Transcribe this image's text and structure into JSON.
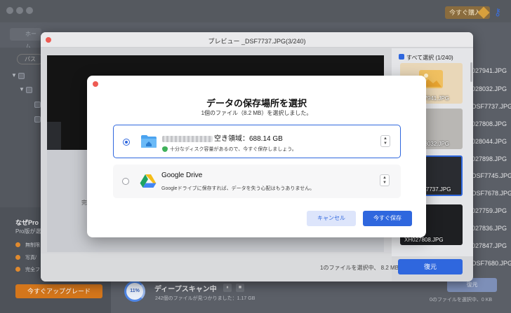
{
  "app": {
    "buy_label": "今すぐ購入",
    "nav_label": "ホーム",
    "path_label": "パス",
    "upsell": {
      "title": "なぜPro",
      "subtitle": "Pro版が選",
      "items": [
        "無制限",
        "写真/",
        "完全フ"
      ]
    },
    "upgrade_button": "今すぐアップグレード",
    "scan": {
      "percent": "11%",
      "title": "ディープスキャン中",
      "pause": "⏸",
      "stop": "■",
      "found": "242個のファイルが見つかりました：1.17 GB"
    },
    "restore_ghost": "復元",
    "selection_ghost": "0のファイルを選択中、0 KB",
    "file_list": [
      "027941.JPG",
      "028032.JPG",
      "DSF7737.JPG",
      "027808.JPG",
      "028044.JPG",
      "027898.JPG",
      "DSF7745.JPG",
      "DSF7678.JPG",
      "027759.JPG",
      "027836.JPG",
      "027847.JPG",
      "DSF7680.JPG"
    ]
  },
  "preview": {
    "title": "プレビュー _DSF7737.JPG(3/240)",
    "select_all": "すべて選択 (1/240)",
    "ghost_text": "完",
    "thumbnails": [
      {
        "caption": "27941.JPG",
        "active": false
      },
      {
        "caption": "28032.JPG",
        "active": false
      },
      {
        "caption": "F7737.JPG",
        "active": true
      },
      {
        "caption": "XH027808.JPG",
        "active": false
      }
    ],
    "selection_count": "1のファイルを選択中、 8.2 MB",
    "restore_button": "復元"
  },
  "dialog": {
    "title": "データの保存場所を選択",
    "subtitle": "1個のファイル（8.2 MB）を選択しました。",
    "options": [
      {
        "title": "空き領域：688.14 GB",
        "description": "十分なディスク容量があるので、今すぐ保存しましょう。",
        "selected": true,
        "icon": "folder-icon"
      },
      {
        "title": "Google Drive",
        "description": "Googleドライブに保存すれば、データを失う心配はもうありません。",
        "selected": false,
        "icon": "google-drive-icon"
      }
    ],
    "cancel_button": "キャンセル",
    "save_button": "今すぐ保存"
  },
  "colors": {
    "accent": "#2f67de",
    "close_red": "#ee5b53",
    "upgrade_orange": "#d4761b",
    "ok_green": "#3fb15a"
  }
}
